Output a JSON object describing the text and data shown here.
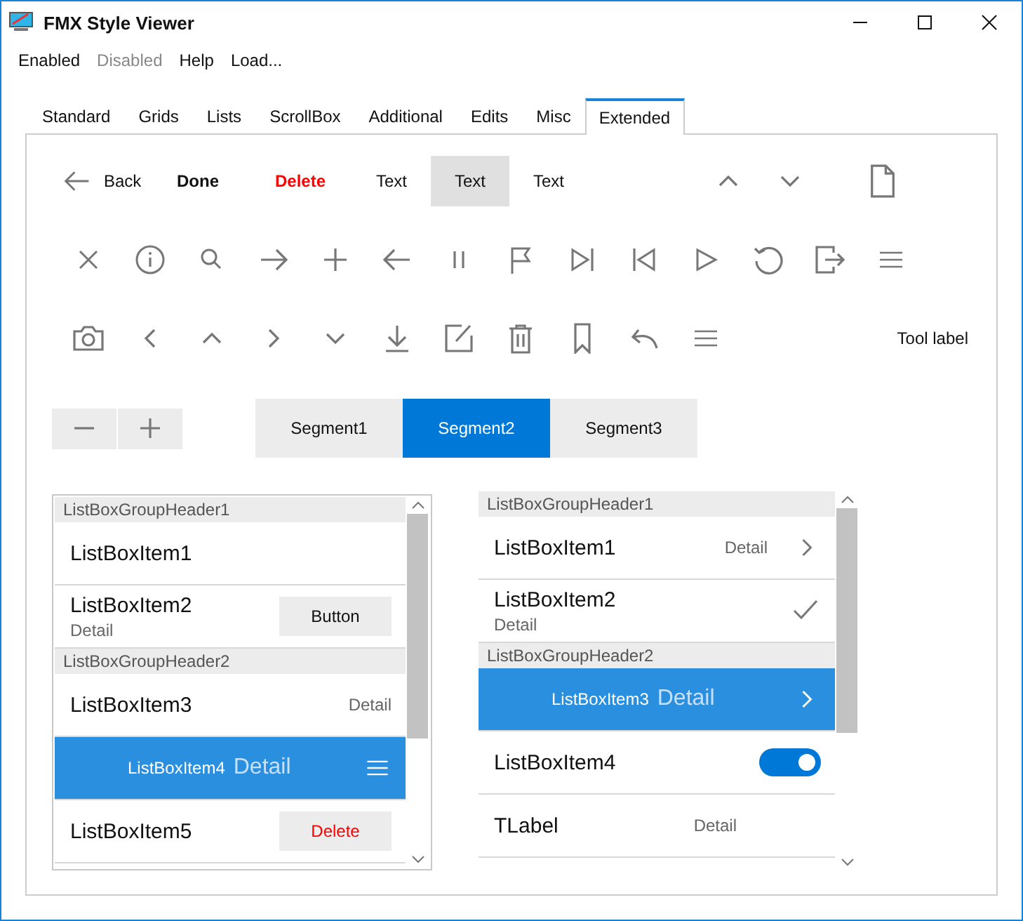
{
  "window": {
    "title": "FMX Style Viewer"
  },
  "menu": [
    {
      "label": "Enabled",
      "disabled": false
    },
    {
      "label": "Disabled",
      "disabled": true
    },
    {
      "label": "Help",
      "disabled": false
    },
    {
      "label": "Load...",
      "disabled": false
    }
  ],
  "tabs": [
    {
      "label": "Standard",
      "selected": false
    },
    {
      "label": "Grids",
      "selected": false
    },
    {
      "label": "Lists",
      "selected": false
    },
    {
      "label": "ScrollBox",
      "selected": false
    },
    {
      "label": "Additional",
      "selected": false
    },
    {
      "label": "Edits",
      "selected": false
    },
    {
      "label": "Misc",
      "selected": false
    },
    {
      "label": "Extended",
      "selected": true
    }
  ],
  "toolbar": {
    "back": "Back",
    "done": "Done",
    "delete": "Delete",
    "texts": [
      {
        "label": "Text",
        "selected": false
      },
      {
        "label": "Text",
        "selected": true
      },
      {
        "label": "Text",
        "selected": false
      }
    ]
  },
  "tool_label": "Tool label",
  "segments": [
    {
      "label": "Segment1",
      "selected": false
    },
    {
      "label": "Segment2",
      "selected": true
    },
    {
      "label": "Segment3",
      "selected": false
    }
  ],
  "lists": [
    {
      "framed": true,
      "items": [
        {
          "kind": "header",
          "text": "ListBoxGroupHeader1"
        },
        {
          "kind": "plain",
          "text": "ListBoxItem1",
          "selected": false
        },
        {
          "kind": "subtitle-button",
          "text": "ListBoxItem2",
          "detail": "Detail",
          "button": "Button",
          "selected": false
        },
        {
          "kind": "header",
          "text": "ListBoxGroupHeader2"
        },
        {
          "kind": "detail",
          "text": "ListBoxItem3",
          "detail": "Detail",
          "selected": false
        },
        {
          "kind": "detail-menu",
          "text": "ListBoxItem4",
          "detail": "Detail",
          "selected": true
        },
        {
          "kind": "delete-button",
          "text": "ListBoxItem5",
          "button": "Delete",
          "selected": false
        }
      ]
    },
    {
      "framed": false,
      "items": [
        {
          "kind": "header",
          "text": "ListBoxGroupHeader1"
        },
        {
          "kind": "detail-chevron",
          "text": "ListBoxItem1",
          "detail": "Detail",
          "selected": false
        },
        {
          "kind": "subtitle-check",
          "text": "ListBoxItem2",
          "detail": "Detail",
          "selected": false
        },
        {
          "kind": "header",
          "text": "ListBoxGroupHeader2"
        },
        {
          "kind": "detail-chevron",
          "text": "ListBoxItem3",
          "detail": "Detail",
          "selected": true
        },
        {
          "kind": "toggle",
          "text": "ListBoxItem4",
          "on": true,
          "selected": false
        },
        {
          "kind": "label",
          "text": "TLabel",
          "detail": "Detail",
          "selected": false
        }
      ]
    }
  ]
}
